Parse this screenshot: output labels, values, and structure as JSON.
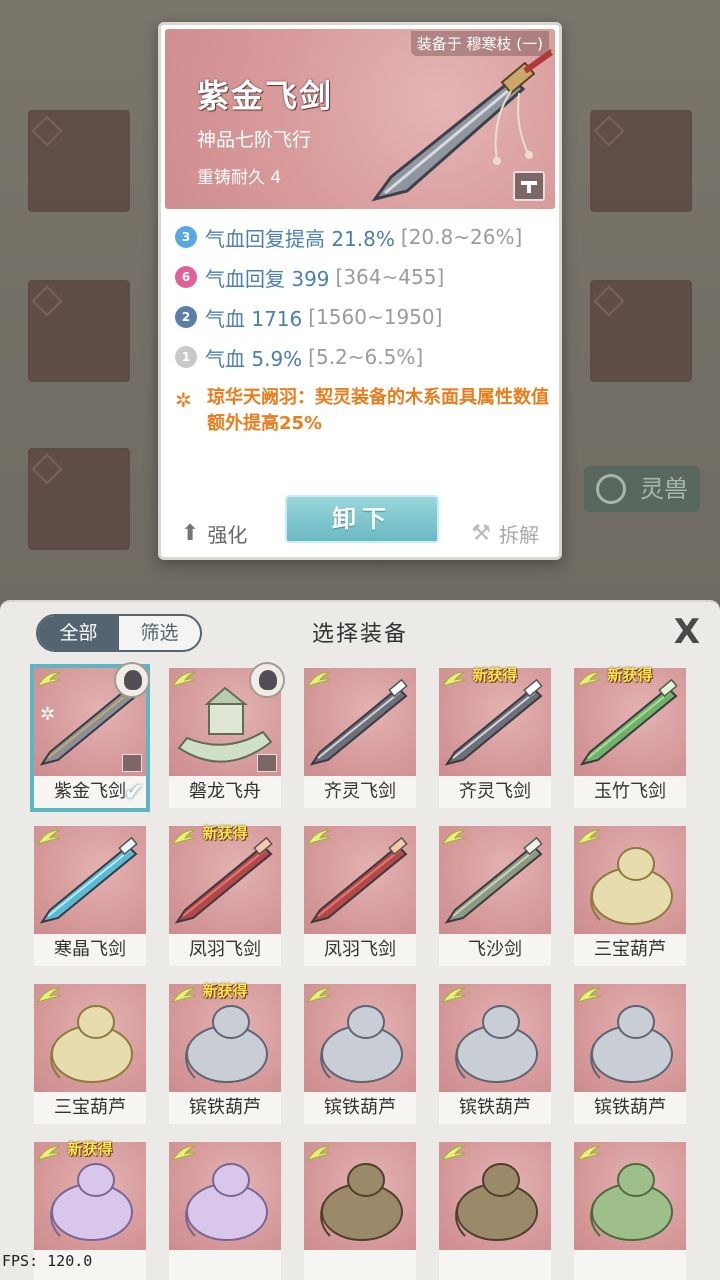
{
  "detail": {
    "equipped_on": "装备于 穆寒枝 (一)",
    "name": "紫金飞剑",
    "grade": "神品七阶飞行",
    "recast": "重铸耐久 4",
    "stats": [
      {
        "rank": "3",
        "badge_color": "#5aa8e0",
        "text": "气血回复提高 21.8%",
        "range": "[20.8~26%]"
      },
      {
        "rank": "6",
        "badge_color": "#e0609a",
        "text": "气血回复 399",
        "range": "[364~455]"
      },
      {
        "rank": "2",
        "badge_color": "#5c7da6",
        "text": "气血 1716",
        "range": "[1560~1950]"
      },
      {
        "rank": "1",
        "badge_color": "#c9c9c9",
        "text": "气血 5.9%",
        "range": "[5.2~6.5%]"
      }
    ],
    "set_bonus": "琼华天阙羽：契灵装备的木系面具属性数值额外提高25%",
    "upgrade_label": "强化",
    "unequip_label": "卸下",
    "dismantle_label": "拆解"
  },
  "background": {
    "beast_button": "灵兽"
  },
  "panel": {
    "filter_all": "全部",
    "filter_screen": "筛选",
    "title": "选择装备",
    "close": "X",
    "new_tag": "新获得",
    "items": [
      {
        "label": "紫金飞剑",
        "kind": "sword-purple",
        "selected": true,
        "new": false
      },
      {
        "label": "磐龙飞舟",
        "kind": "boat",
        "selected": false,
        "new": false
      },
      {
        "label": "齐灵飞剑",
        "kind": "sword-gray",
        "selected": false,
        "new": false
      },
      {
        "label": "齐灵飞剑",
        "kind": "sword-gray",
        "selected": false,
        "new": true
      },
      {
        "label": "玉竹飞剑",
        "kind": "sword-green",
        "selected": false,
        "new": true
      },
      {
        "label": "寒晶飞剑",
        "kind": "sword-ice",
        "selected": false,
        "new": false
      },
      {
        "label": "凤羽飞剑",
        "kind": "sword-red",
        "selected": false,
        "new": true
      },
      {
        "label": "凤羽飞剑",
        "kind": "sword-red",
        "selected": false,
        "new": false
      },
      {
        "label": "飞沙剑",
        "kind": "sword-sand",
        "selected": false,
        "new": false
      },
      {
        "label": "三宝葫芦",
        "kind": "gourd-gold",
        "selected": false,
        "new": false
      },
      {
        "label": "三宝葫芦",
        "kind": "gourd-gold",
        "selected": false,
        "new": false
      },
      {
        "label": "镔铁葫芦",
        "kind": "gourd-iron",
        "selected": false,
        "new": true
      },
      {
        "label": "镔铁葫芦",
        "kind": "gourd-iron",
        "selected": false,
        "new": false
      },
      {
        "label": "镔铁葫芦",
        "kind": "gourd-iron",
        "selected": false,
        "new": false
      },
      {
        "label": "镔铁葫芦",
        "kind": "gourd-iron",
        "selected": false,
        "new": false
      },
      {
        "label": "",
        "kind": "gourd-purple",
        "selected": false,
        "new": true
      },
      {
        "label": "",
        "kind": "gourd-purple",
        "selected": false,
        "new": false
      },
      {
        "label": "",
        "kind": "beast-bag",
        "selected": false,
        "new": false
      },
      {
        "label": "",
        "kind": "beast-bag",
        "selected": false,
        "new": false
      },
      {
        "label": "",
        "kind": "jade-toad",
        "selected": false,
        "new": false
      }
    ]
  },
  "fps": "FPS: 120.0"
}
